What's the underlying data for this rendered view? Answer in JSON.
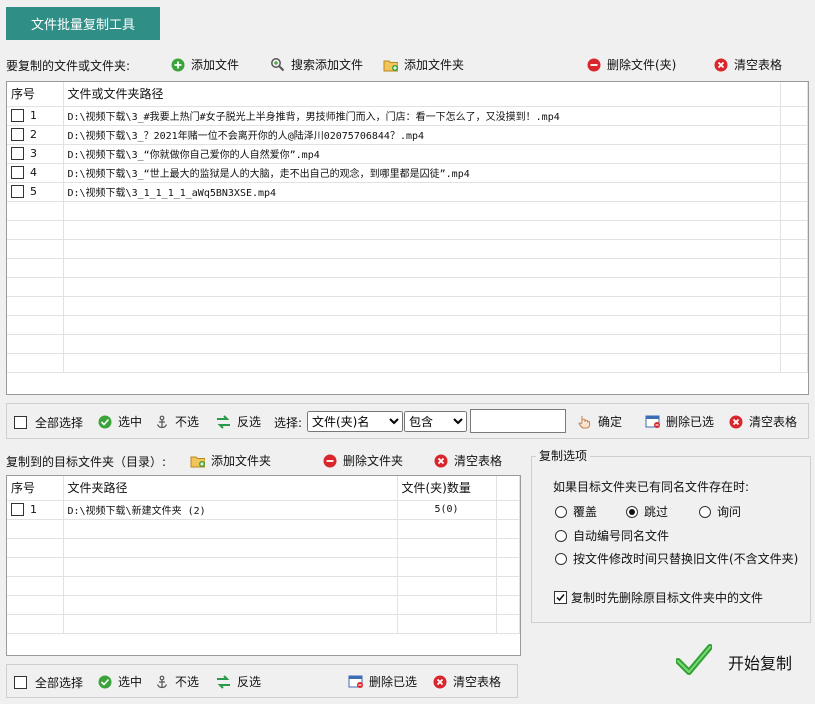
{
  "app_title": "文件批量复制工具",
  "source": {
    "label": "要复制的文件或文件夹:",
    "buttons": {
      "add_file": "添加文件",
      "search_add_file": "搜索添加文件",
      "add_folder": "添加文件夹",
      "delete_file": "删除文件(夹)",
      "clear_table": "清空表格"
    },
    "columns": [
      "序号",
      "文件或文件夹路径"
    ],
    "rows": [
      {
        "no": "1",
        "path": "D:\\视频下载\\3_#我要上热门#女子脱光上半身推背，男技师推门而入，门店：看一下怎么了，又没摸到！.mp4"
      },
      {
        "no": "2",
        "path": "D:\\视频下载\\3_？2021年赌一位不会离开你的人@陆泽川02075706844？.mp4"
      },
      {
        "no": "3",
        "path": "D:\\视频下载\\3_“你就做你自己爱你的人自然爱你”.mp4"
      },
      {
        "no": "4",
        "path": "D:\\视频下载\\3_“世上最大的监狱是人的大脑，走不出自己的观念，到哪里都是囚徒”.mp4"
      },
      {
        "no": "5",
        "path": "D:\\视频下载\\3_1_1_1_1_aWq5BN3XSE.mp4"
      }
    ]
  },
  "source_toolbar": {
    "select_all": "全部选择",
    "select": "选中",
    "unselect": "不选",
    "invert": "反选",
    "choose_label": "选择:",
    "field_option": "文件(夹)名",
    "match_option": "包含",
    "filter_value": "",
    "confirm": "确定",
    "delete_selected": "删除已选",
    "clear_table": "清空表格"
  },
  "target": {
    "label": "复制到的目标文件夹（目录）:",
    "buttons": {
      "add_folder": "添加文件夹",
      "delete_folder": "删除文件夹",
      "clear_table": "清空表格"
    },
    "columns": [
      "序号",
      "文件夹路径",
      "文件(夹)数量"
    ],
    "rows": [
      {
        "no": "1",
        "path": "D:\\视频下载\\新建文件夹 (2)",
        "count": "5(0)"
      }
    ]
  },
  "target_toolbar": {
    "select_all": "全部选择",
    "select": "选中",
    "unselect": "不选",
    "invert": "反选",
    "delete_selected": "删除已选",
    "clear_table": "清空表格"
  },
  "options": {
    "title": "复制选项",
    "conflict_label": "如果目标文件夹已有同名文件存在时:",
    "overwrite": "覆盖",
    "skip": "跳过",
    "ask": "询问",
    "auto_rename": "自动编号同名文件",
    "replace_older": "按文件修改时间只替换旧文件(不含文件夹)",
    "delete_before": "复制时先删除原目标文件夹中的文件",
    "selected": "skip",
    "delete_before_checked": true
  },
  "start_button": "开始复制",
  "colors": {
    "accent": "#2f8f87",
    "green": "#3aa33a",
    "red": "#d9262c"
  }
}
